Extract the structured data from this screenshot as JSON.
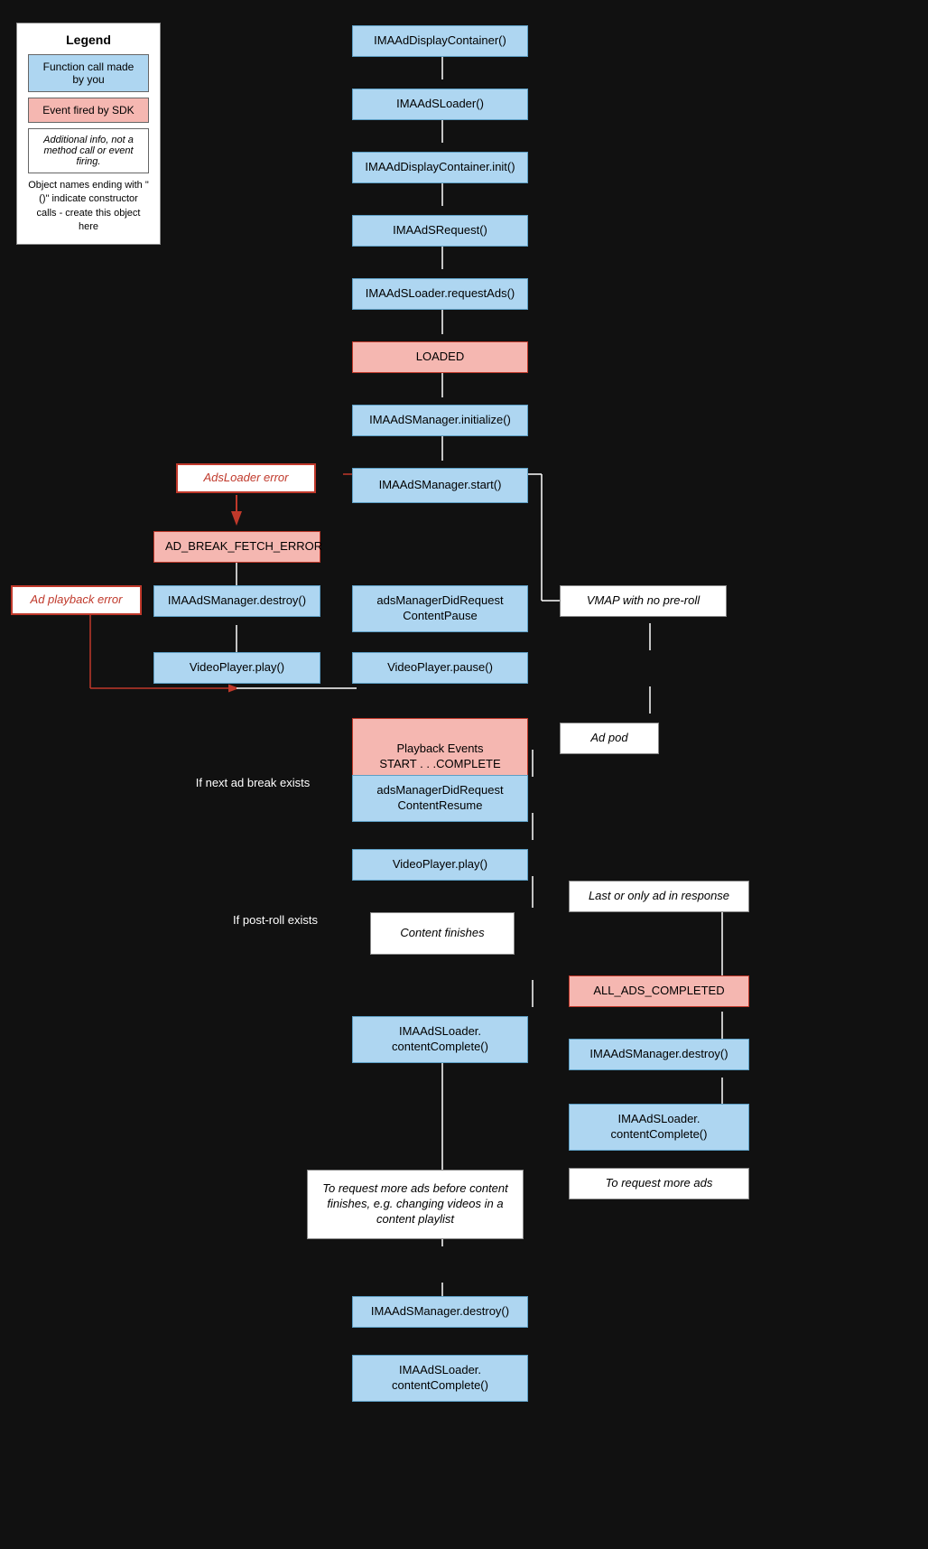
{
  "legend": {
    "title": "Legend",
    "blue_label": "Function call made by you",
    "pink_label": "Event fired by SDK",
    "italic_label": "Additional info, not a method call or event firing.",
    "note": "Object names ending with \"()\" indicate constructor calls - create this object here"
  },
  "nodes": {
    "ima_display_container": "IMAAd​DisplayContainer()",
    "ima_ads_loader": "IMAAdSLoader()",
    "ima_display_container_init": "IMAAd​DisplayContainer.init()",
    "ima_ads_request": "IMAAdSRequest()",
    "ima_ads_loader_request": "IMAAdSLoader.​requestAds()",
    "loaded": "LOADED",
    "ima_ads_manager_init": "IMAAdSManager.​initialize()",
    "ima_ads_manager_start": "IMAAdSManager.​start()",
    "ads_loader_error": "AdsLoader error",
    "ad_break_fetch_error": "AD_BREAK_FETCH_ERROR",
    "ad_playback_error": "Ad playback error",
    "ima_ads_manager_destroy": "IMAAdSManager.​destroy()",
    "video_player_play": "VideoPlayer.​play()",
    "ads_manager_did_request_content_pause": "adsManagerDidRequest​ContentPause",
    "video_player_pause": "VideoPlayer.​pause()",
    "playback_events": "Playback Events\nSTART . . .COMPLETE",
    "ad_pod": "Ad pod",
    "if_next_ad_break": "If next ad break exists",
    "ads_manager_did_request_content_resume": "adsManagerDidRequest​ContentResume",
    "video_player_play2": "VideoPlayer.​play()",
    "if_post_roll": "If post-roll exists",
    "content_finishes": "Content finishes",
    "last_or_only": "Last or only ad in response",
    "all_ads_completed": "ALL_ADS_COMPLETED",
    "ima_ads_loader_content_complete": "IMAAdSLoader.​contentComplete()",
    "ima_ads_manager_destroy2": "IMAAdSManager.​destroy()",
    "ima_ads_loader_content_complete2": "IMAAdSLoader.​contentComplete()",
    "to_request_more_ads_label": "To request more ads",
    "to_request_more_before_content": "To request more ads before content finishes, e.g. changing videos in a content playlist",
    "ima_ads_manager_destroy3": "IMAAdSManager.​destroy()",
    "ima_ads_loader_content_complete3": "IMAAdSLoader.​contentComplete()",
    "vmap_no_preroll": "VMAP with no pre-roll"
  }
}
